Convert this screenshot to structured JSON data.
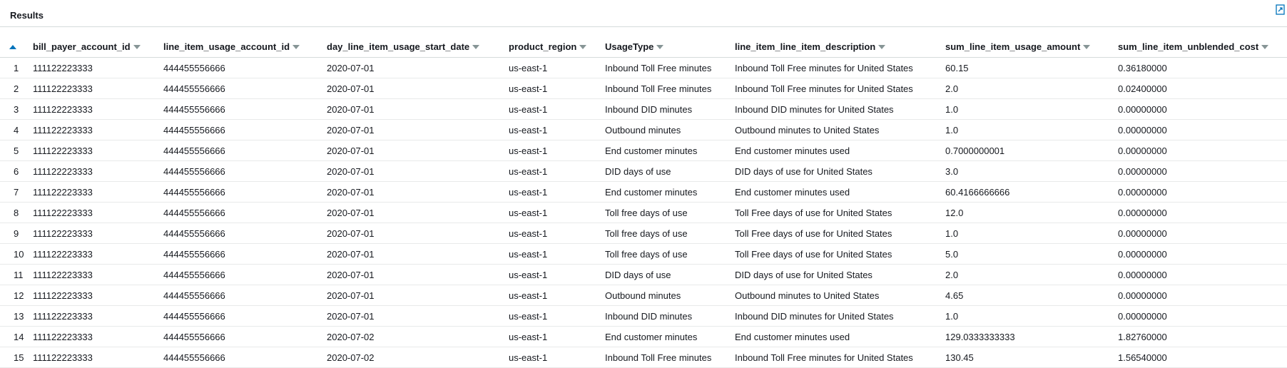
{
  "results": {
    "title": "Results",
    "export_icon": "external-link-icon",
    "columns": [
      "bill_payer_account_id",
      "line_item_usage_account_id",
      "day_line_item_usage_start_date",
      "product_region",
      "UsageType",
      "line_item_line_item_description",
      "sum_line_item_usage_amount",
      "sum_line_item_unblended_cost"
    ],
    "rows": [
      [
        "1",
        "111122223333",
        "444455556666",
        "2020-07-01",
        "us-east-1",
        "Inbound Toll Free minutes",
        "Inbound Toll Free minutes for United States",
        "60.15",
        "0.36180000"
      ],
      [
        "2",
        "111122223333",
        "444455556666",
        "2020-07-01",
        "us-east-1",
        "Inbound Toll Free minutes",
        "Inbound Toll Free minutes for United States",
        "2.0",
        "0.02400000"
      ],
      [
        "3",
        "111122223333",
        "444455556666",
        "2020-07-01",
        "us-east-1",
        "Inbound DID minutes",
        "Inbound DID minutes for United States",
        "1.0",
        "0.00000000"
      ],
      [
        "4",
        "111122223333",
        "444455556666",
        "2020-07-01",
        "us-east-1",
        "Outbound minutes",
        "Outbound minutes to United States",
        "1.0",
        "0.00000000"
      ],
      [
        "5",
        "111122223333",
        "444455556666",
        "2020-07-01",
        "us-east-1",
        "End customer minutes",
        "End customer minutes used",
        "0.7000000001",
        "0.00000000"
      ],
      [
        "6",
        "111122223333",
        "444455556666",
        "2020-07-01",
        "us-east-1",
        "DID days of use",
        "DID days of use for United States",
        "3.0",
        "0.00000000"
      ],
      [
        "7",
        "111122223333",
        "444455556666",
        "2020-07-01",
        "us-east-1",
        "End customer minutes",
        "End customer minutes used",
        "60.4166666666",
        "0.00000000"
      ],
      [
        "8",
        "111122223333",
        "444455556666",
        "2020-07-01",
        "us-east-1",
        "Toll free days of use",
        "Toll Free days of use for United States",
        "12.0",
        "0.00000000"
      ],
      [
        "9",
        "111122223333",
        "444455556666",
        "2020-07-01",
        "us-east-1",
        "Toll free days of use",
        "Toll Free days of use for United States",
        "1.0",
        "0.00000000"
      ],
      [
        "10",
        "111122223333",
        "444455556666",
        "2020-07-01",
        "us-east-1",
        "Toll free days of use",
        "Toll Free days of use for United States",
        "5.0",
        "0.00000000"
      ],
      [
        "11",
        "111122223333",
        "444455556666",
        "2020-07-01",
        "us-east-1",
        "DID days of use",
        "DID days of use for United States",
        "2.0",
        "0.00000000"
      ],
      [
        "12",
        "111122223333",
        "444455556666",
        "2020-07-01",
        "us-east-1",
        "Outbound minutes",
        "Outbound minutes to United States",
        "4.65",
        "0.00000000"
      ],
      [
        "13",
        "111122223333",
        "444455556666",
        "2020-07-01",
        "us-east-1",
        "Inbound DID minutes",
        "Inbound DID minutes for United States",
        "1.0",
        "0.00000000"
      ],
      [
        "14",
        "111122223333",
        "444455556666",
        "2020-07-02",
        "us-east-1",
        "End customer minutes",
        "End customer minutes used",
        "129.0333333333",
        "1.82760000"
      ],
      [
        "15",
        "111122223333",
        "444455556666",
        "2020-07-02",
        "us-east-1",
        "Inbound Toll Free minutes",
        "Inbound Toll Free minutes for United States",
        "130.45",
        "1.56540000"
      ]
    ]
  },
  "colors": {
    "accent": "#0073bb",
    "caret": "#879596",
    "border": "#d5dbdb"
  }
}
